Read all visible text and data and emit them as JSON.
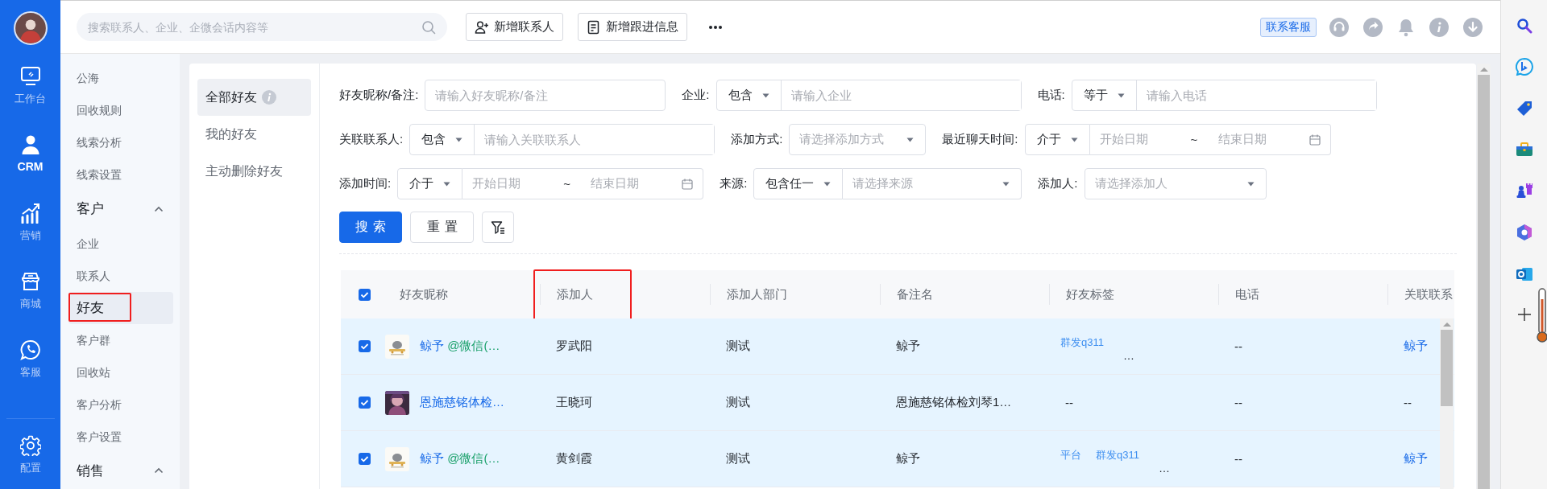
{
  "rail": {
    "items": [
      {
        "label": "工作台",
        "selected": false
      },
      {
        "label": "CRM",
        "selected": true
      },
      {
        "label": "营销",
        "selected": false
      },
      {
        "label": "商城",
        "selected": false
      },
      {
        "label": "客服",
        "selected": false
      }
    ],
    "footer": {
      "label": "配置"
    }
  },
  "top_bar": {
    "search": {
      "placeholder": "搜索联系人、企业、企微会话内容等"
    },
    "buttons": [
      {
        "label": "新增联系人"
      },
      {
        "label": "新增跟进信息"
      }
    ],
    "support": "联系客服"
  },
  "menu": [
    {
      "kind": "item",
      "label": "公海",
      "selected": false,
      "highlighted": false
    },
    {
      "kind": "item",
      "label": "回收规则",
      "selected": false,
      "highlighted": false
    },
    {
      "kind": "item",
      "label": "线索分析",
      "selected": false,
      "highlighted": false
    },
    {
      "kind": "item",
      "label": "线索设置",
      "selected": false,
      "highlighted": false
    },
    {
      "kind": "group",
      "label": "客户",
      "expanded": true,
      "children": [
        {
          "kind": "item",
          "label": "企业",
          "selected": false,
          "highlighted": false
        },
        {
          "kind": "item",
          "label": "联系人",
          "selected": false,
          "highlighted": false
        },
        {
          "kind": "item",
          "label": "好友",
          "selected": true,
          "highlighted": true
        },
        {
          "kind": "item",
          "label": "客户群",
          "selected": false,
          "highlighted": false
        },
        {
          "kind": "item",
          "label": "回收站",
          "selected": false,
          "highlighted": false
        },
        {
          "kind": "item",
          "label": "客户分析",
          "selected": false,
          "highlighted": false
        },
        {
          "kind": "item",
          "label": "客户设置",
          "selected": false,
          "highlighted": false
        }
      ]
    },
    {
      "kind": "group",
      "label": "销售",
      "expanded": true
    }
  ],
  "subnav": [
    {
      "label": "全部好友",
      "selected": true,
      "info": true
    },
    {
      "label": "我的好友",
      "selected": false,
      "info": false
    },
    {
      "label": "主动删除好友",
      "selected": false,
      "info": false
    }
  ],
  "filters": [
    [
      {
        "kind": "text",
        "label": "好友昵称/备注:",
        "placeholder": "请输入好友昵称/备注"
      },
      {
        "kind": "op_text",
        "label": "企业:",
        "operator": "包含",
        "placeholder": "请输入企业"
      },
      {
        "kind": "op_text",
        "label": "电话:",
        "operator": "等于",
        "placeholder": "请输入电话"
      }
    ],
    [
      {
        "kind": "op_text",
        "label": "关联联系人:",
        "operator": "包含",
        "placeholder": "请输入关联联系人"
      },
      {
        "kind": "select",
        "label": "添加方式:",
        "placeholder": "请选择添加方式"
      },
      {
        "kind": "op_range",
        "label": "最近聊天时间:",
        "operator": "介于",
        "start": "开始日期",
        "separator": "~",
        "end": "结束日期"
      }
    ],
    [
      {
        "kind": "op_range",
        "label": "添加时间:",
        "operator": "介于",
        "start": "开始日期",
        "separator": "~",
        "end": "结束日期"
      },
      {
        "kind": "op_select",
        "label": "来源:",
        "operator": "包含任一",
        "placeholder": "请选择来源"
      },
      {
        "kind": "wide_select",
        "label": "添加人:",
        "placeholder": "请选择添加人"
      }
    ]
  ],
  "actions": {
    "search": "搜索",
    "reset": "重置"
  },
  "table": {
    "all_checked": true,
    "columns": [
      {
        "label": "好友昵称",
        "highlighted": false
      },
      {
        "label": "添加人",
        "highlighted": true
      },
      {
        "label": "添加人部门",
        "highlighted": false
      },
      {
        "label": "备注名",
        "highlighted": false
      },
      {
        "label": "好友标签",
        "highlighted": false
      },
      {
        "label": "电话",
        "highlighted": false
      },
      {
        "label": "关联联系",
        "highlighted": false
      }
    ],
    "rows": [
      {
        "checked": true,
        "name": "鲸予",
        "source": "@微信(…",
        "adder": "罗武阳",
        "department": "测试",
        "remark": "鲸予",
        "tags": [
          "群发q311"
        ],
        "tags_more": "…",
        "phone": "--",
        "contact": "鲸予",
        "contact_link": true
      },
      {
        "checked": true,
        "name": "恩施慈铭体检…",
        "adder": "王晓珂",
        "department": "测试",
        "remark": "恩施慈铭体检刘琴1…",
        "tags_empty": "--",
        "phone": "--",
        "contact": "--",
        "contact_link": false
      },
      {
        "checked": true,
        "name": "鲸予",
        "source": "@微信(…",
        "adder": "黄剑霞",
        "department": "测试",
        "remark": "鲸予",
        "tags": [
          "平台",
          "群发q311"
        ],
        "tags_more": "…",
        "phone": "--",
        "contact": "鲸予",
        "contact_link": true
      }
    ]
  }
}
